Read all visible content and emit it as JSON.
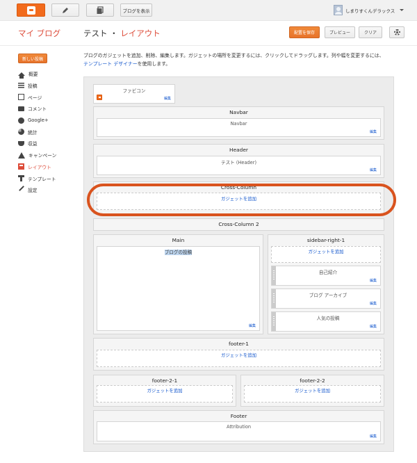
{
  "topbar": {
    "view_blog_label": "ブログを表示",
    "user_name": "しまりすくんデラックス",
    "icons": [
      "blogger-logo-icon",
      "pencil-icon",
      "pages-icon",
      "chevron-down-icon"
    ]
  },
  "header": {
    "blog_name": "マイ ブログ",
    "title_main": "テスト",
    "title_sep": "・",
    "title_sub": "レイアウト",
    "save_label": "配置を保存",
    "preview_label": "プレビュー",
    "clear_label": "クリア"
  },
  "sidebar": {
    "new_post_label": "新しい投稿",
    "items": [
      {
        "label": "概要",
        "icon": "home-icon"
      },
      {
        "label": "投稿",
        "icon": "list-icon"
      },
      {
        "label": "ページ",
        "icon": "page-icon"
      },
      {
        "label": "コメント",
        "icon": "comment-icon"
      },
      {
        "label": "Google+",
        "icon": "google-plus-icon"
      },
      {
        "label": "統計",
        "icon": "stats-icon"
      },
      {
        "label": "収益",
        "icon": "trophy-icon"
      },
      {
        "label": "キャンペーン",
        "icon": "campaign-icon"
      },
      {
        "label": "レイアウト",
        "icon": "layout-icon",
        "active": true
      },
      {
        "label": "テンプレート",
        "icon": "template-icon"
      },
      {
        "label": "設定",
        "icon": "wrench-icon"
      }
    ]
  },
  "intro": {
    "text1": "ブログのガジェットを追加、削除、編集します。ガジェットの場所を変更するには、クリックしてドラッグします。列や幅を変更するには、",
    "link": "テンプレート デザイナー",
    "text2": "を使用します。"
  },
  "layout": {
    "edit_label": "編集",
    "add_gadget_label": "ガジェットを追加",
    "favicon": {
      "name": "ファビコン"
    },
    "navbar": {
      "title": "Navbar",
      "widget": "Navbar"
    },
    "header": {
      "title": "Header",
      "widget": "テスト (Header)"
    },
    "cross_column": {
      "title": "Cross-Column"
    },
    "cross_column_2": {
      "title": "Cross-Column 2"
    },
    "main": {
      "title": "Main",
      "widget": "ブログの投稿"
    },
    "sidebar_right": {
      "title": "sidebar-right-1",
      "widgets": [
        "自己紹介",
        "ブログ アーカイブ",
        "人気の投稿"
      ]
    },
    "footer_1": {
      "title": "footer-1"
    },
    "footer_2_1": {
      "title": "footer-2-1"
    },
    "footer_2_2": {
      "title": "footer-2-2"
    },
    "footer": {
      "title": "Footer",
      "widget": "Attribution"
    }
  },
  "colors": {
    "accent": "#dd4b39",
    "brand_orange": "#f26b1d",
    "highlight_ring": "#d9531e",
    "link": "#1155cc"
  }
}
